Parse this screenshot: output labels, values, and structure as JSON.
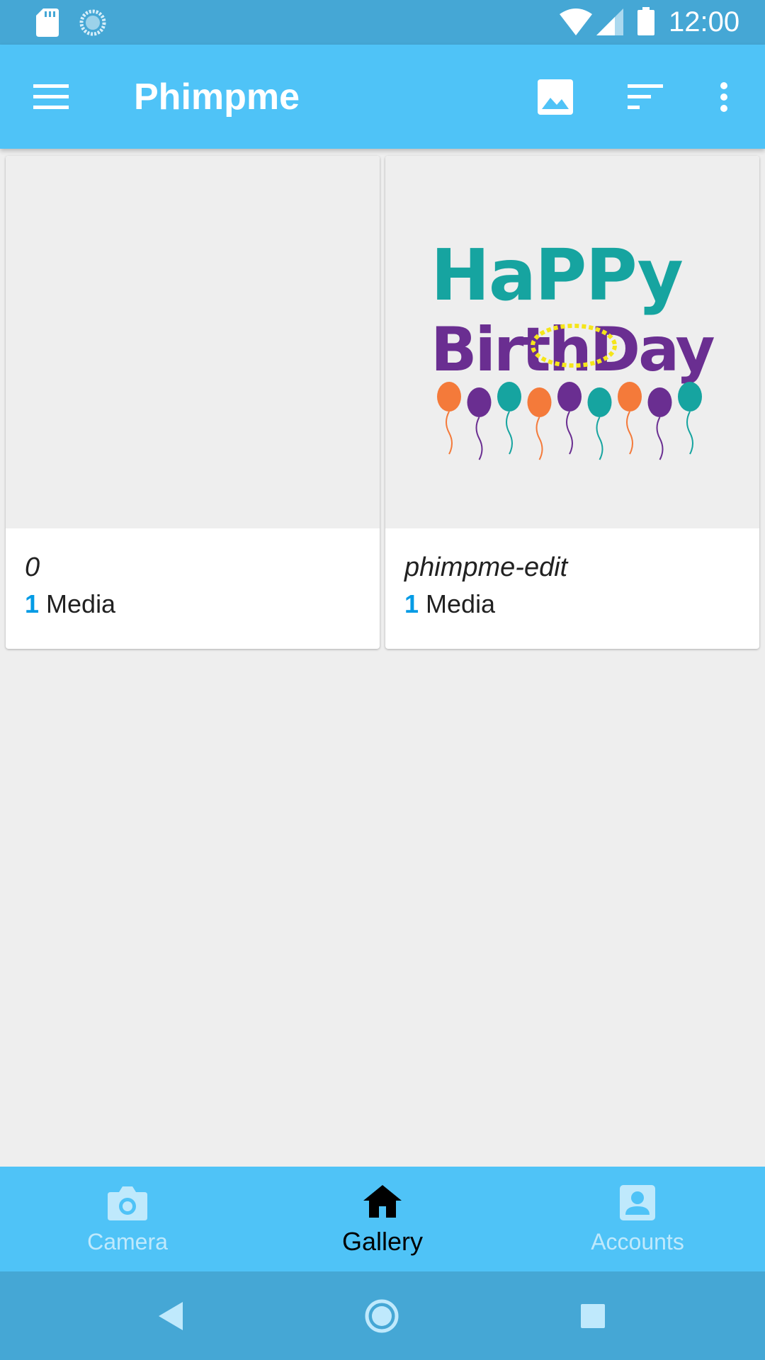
{
  "status_bar": {
    "time": "12:00",
    "icons": [
      "sd-card-icon",
      "sync-icon",
      "wifi-icon",
      "cell-signal-icon",
      "battery-icon"
    ]
  },
  "toolbar": {
    "title": "Phimpme",
    "actions": [
      "menu-icon",
      "image-icon",
      "sort-icon",
      "more-vert-icon"
    ]
  },
  "albums": [
    {
      "name": "0",
      "count": "1",
      "count_label": "Media",
      "thumbnail": "empty"
    },
    {
      "name": "phimpme-edit",
      "count": "1",
      "count_label": "Media",
      "thumbnail": "happy-birthday-image"
    }
  ],
  "thumbnail_art": {
    "line1": "HaPPy",
    "line2": "BirthDay"
  },
  "bottom_nav": {
    "items": [
      {
        "label": "Camera",
        "icon": "camera-icon",
        "active": false
      },
      {
        "label": "Gallery",
        "icon": "home-icon",
        "active": true
      },
      {
        "label": "Accounts",
        "icon": "account-box-icon",
        "active": false
      }
    ]
  },
  "colors": {
    "status_bar": "#45a7d5",
    "toolbar": "#4fc3f7",
    "accent_count": "#039be5",
    "background": "#eeeeee",
    "inactive_nav": "#bfe9fc"
  }
}
